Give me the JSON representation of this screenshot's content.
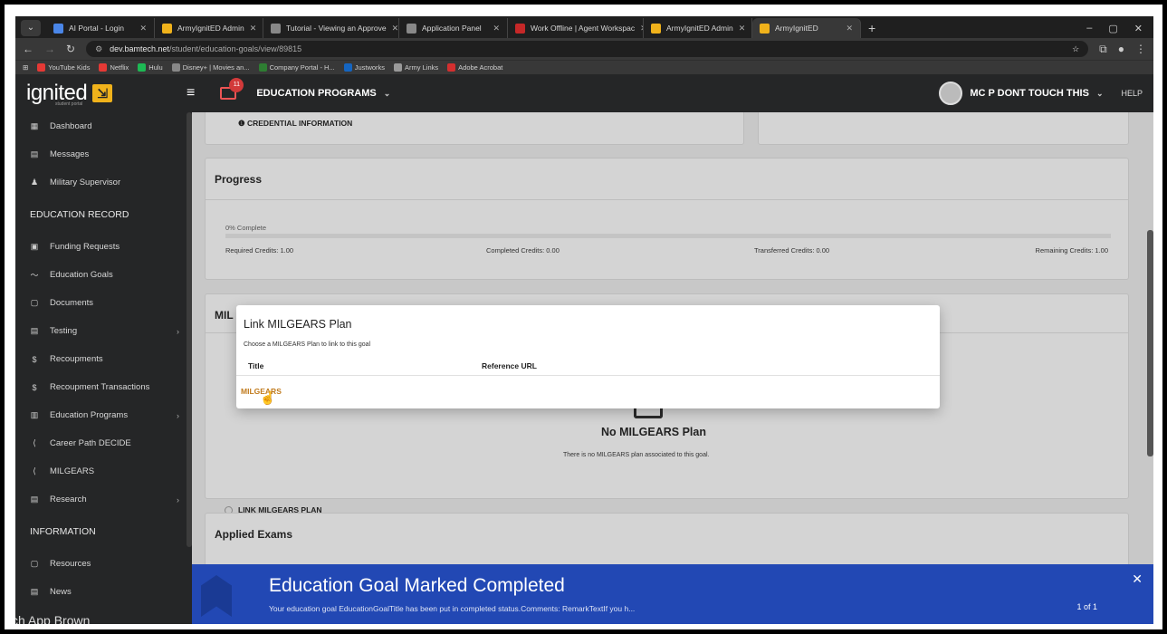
{
  "browser": {
    "tabs": [
      {
        "label": "AI Portal - Login",
        "color": "#4a86e8"
      },
      {
        "label": "ArmyIgnitED Admin",
        "color": "#f0b21b"
      },
      {
        "label": "Tutorial - Viewing an Approve",
        "color": "#888888"
      },
      {
        "label": "Application Panel",
        "color": "#888888"
      },
      {
        "label": "Work Offline | Agent Workspac",
        "color": "#c62828"
      },
      {
        "label": "ArmyIgnitED Admin",
        "color": "#f0b21b"
      },
      {
        "label": "ArmyIgnitED",
        "color": "#f0b21b"
      }
    ],
    "url_host": "dev.bamtech.net",
    "url_path": "/student/education-goals/view/89815",
    "bookmarks": [
      "YouTube Kids",
      "Netflix",
      "Hulu",
      "Disney+ | Movies an...",
      "Company Portal - H...",
      "Justworks",
      "Army Links",
      "Adobe Acrobat"
    ]
  },
  "header": {
    "logo_text": "ignited",
    "logo_sub": "student portal",
    "mail_count": "11",
    "section": "EDUCATION PROGRAMS",
    "user": "MC P DONT TOUCH THIS",
    "help": "HELP"
  },
  "sidebar": {
    "top": [
      {
        "label": "Dashboard",
        "icon": "dashboard-icon"
      },
      {
        "label": "Messages",
        "icon": "messages-icon"
      },
      {
        "label": "Military Supervisor",
        "icon": "supervisor-icon"
      }
    ],
    "section1": "EDUCATION RECORD",
    "record": [
      {
        "label": "Funding Requests",
        "icon": "funding-icon"
      },
      {
        "label": "Education Goals",
        "icon": "goals-icon"
      },
      {
        "label": "Documents",
        "icon": "documents-icon"
      },
      {
        "label": "Testing",
        "icon": "testing-icon"
      },
      {
        "label": "Recoupments",
        "icon": "dollar-icon"
      },
      {
        "label": "Recoupment Transactions",
        "icon": "dollar-icon"
      },
      {
        "label": "Education Programs",
        "icon": "programs-icon"
      },
      {
        "label": "Career Path DECIDE",
        "icon": "career-icon"
      },
      {
        "label": "MILGEARS",
        "icon": "milgears-icon"
      },
      {
        "label": "Research",
        "icon": "research-icon"
      }
    ],
    "section2": "INFORMATION",
    "info": [
      {
        "label": "Resources",
        "icon": "resources-icon"
      },
      {
        "label": "News",
        "icon": "news-icon"
      }
    ],
    "footer_fragment": "ch App Brown"
  },
  "main": {
    "credential_info": "CREDENTIAL INFORMATION",
    "progress": {
      "title": "Progress",
      "percent_text": "0% Complete",
      "fraction": 0,
      "required": "Required Credits: 1.00",
      "completed": "Completed Credits: 0.00",
      "transferred": "Transferred Credits: 0.00",
      "remaining": "Remaining Credits: 1.00"
    },
    "milgears_card": {
      "title_fragment": "MIL",
      "empty_title": "No MILGEARS Plan",
      "empty_text": "There is no MILGEARS plan associated to this goal.",
      "link_label": "LINK MILGEARS PLAN"
    },
    "applied_exams": "Applied Exams"
  },
  "modal": {
    "title": "Link MILGEARS Plan",
    "subtitle": "Choose a MILGEARS Plan to link to this goal",
    "col_title": "Title",
    "col_ref": "Reference URL",
    "row_link": "MILGEARS"
  },
  "toast": {
    "title": "Education Goal Marked Completed",
    "message": "Your education goal EducationGoalTitle has been put in completed status.Comments: RemarkTextIf you h...",
    "pager": "1 of 1"
  },
  "colors": {
    "accent": "#f0b21b",
    "toast": "#2248b4",
    "link": "#c07a1c"
  }
}
